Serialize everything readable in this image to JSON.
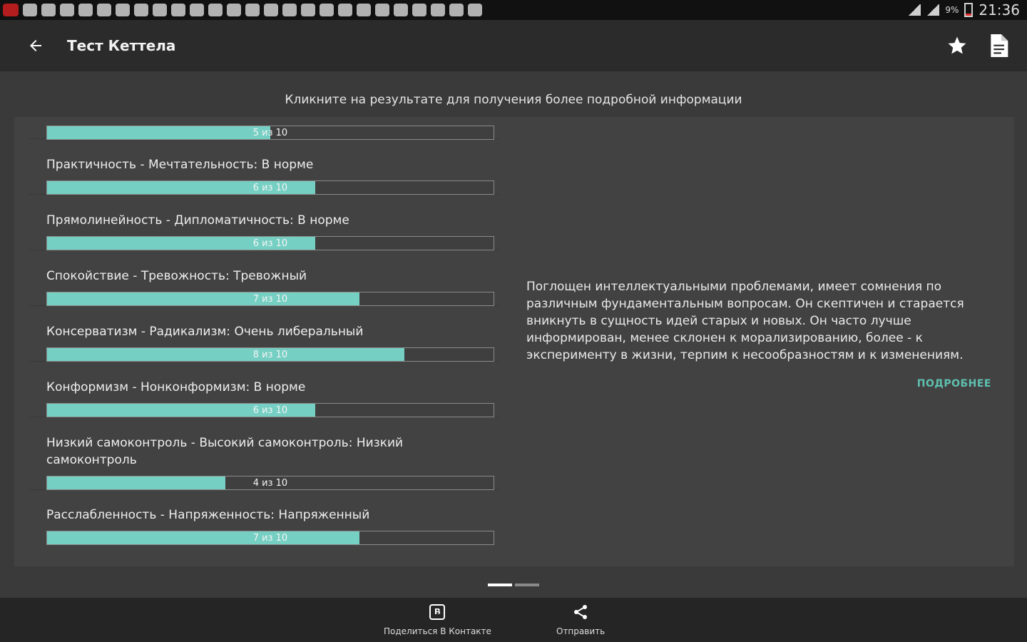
{
  "statusbar": {
    "battery": "9%",
    "time": "21:36"
  },
  "appbar": {
    "title": "Тест Кеттела"
  },
  "hint": "Кликните на результате для получения более подробной информации",
  "results": [
    {
      "label": "",
      "score": 5,
      "bar_text": "5 из 10"
    },
    {
      "label": "Практичность - Мечтательность: В норме",
      "score": 6,
      "bar_text": "6 из 10"
    },
    {
      "label": "Прямолинейность - Дипломатичность: В норме",
      "score": 6,
      "bar_text": "6 из 10"
    },
    {
      "label": "Спокойствие - Тревожность: Тревожный",
      "score": 7,
      "bar_text": "7 из 10"
    },
    {
      "label": "Консерватизм - Радикализм: Очень либеральный",
      "score": 8,
      "bar_text": "8 из 10"
    },
    {
      "label": "Конформизм - Нонконформизм: В норме",
      "score": 6,
      "bar_text": "6 из 10"
    },
    {
      "label": "Низкий самоконтроль - Высокий самоконтроль: Низкий самоконтроль",
      "score": 4,
      "bar_text": "4 из 10"
    },
    {
      "label": "Расслабленность - Напряженность: Напряженный",
      "score": 7,
      "bar_text": "7 из 10"
    }
  ],
  "detail": {
    "text": "Поглощен интеллектуальными проблемами, имеет сомнения по различным фундаментальным вопросам. Он скептичен и старается вникнуть в сущность идей старых и новых. Он часто лучше информирован, менее склонен к морализированию, более - к эксперименту в жизни, терпим к несообразностям и к изменениям.",
    "more_label": "ПОДРОБНЕЕ"
  },
  "bottom": {
    "share_vk_label": "Поделиться В Контакте",
    "send_label": "Отправить"
  },
  "colors": {
    "accent": "#76cfc3",
    "link": "#5fc0b0",
    "appbar": "#2b2b2b",
    "background": "#3a3a3a"
  }
}
